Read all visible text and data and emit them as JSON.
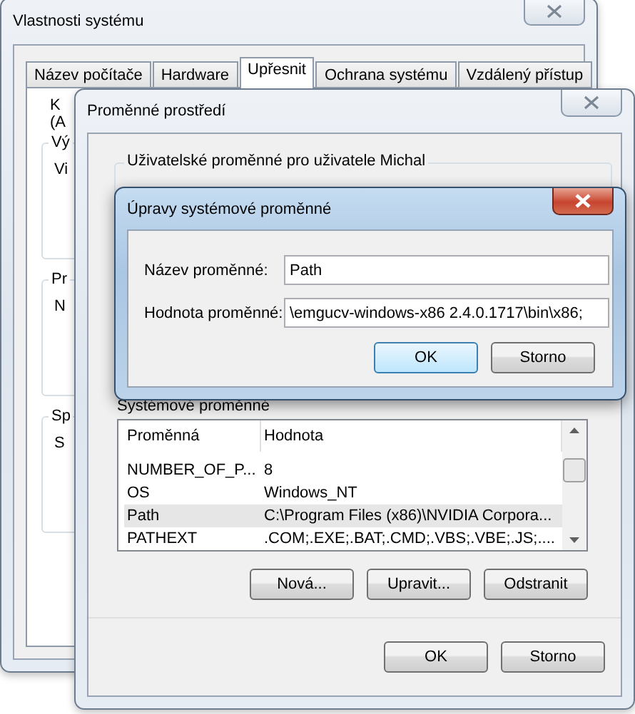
{
  "system_properties": {
    "title": "Vlastnosti systému",
    "tabs": [
      {
        "label": "Název počítače",
        "selected": false
      },
      {
        "label": "Hardware",
        "selected": false
      },
      {
        "label": "Upřesnit",
        "selected": true
      },
      {
        "label": "Ochrana systému",
        "selected": false
      },
      {
        "label": "Vzdálený přístup",
        "selected": false
      }
    ],
    "intro_lines": [
      "K",
      "(A"
    ],
    "groups": [
      {
        "legend": "Vý",
        "line": "Vi"
      },
      {
        "legend": "Pr",
        "line": "N"
      },
      {
        "legend": "Sp",
        "line": "S"
      }
    ]
  },
  "environment_variables": {
    "title": "Proměnné prostředí",
    "user_section": "Uživatelské proměnné pro uživatele Michal",
    "system_section": "Systémové proměnné",
    "columns": [
      "Proměnná",
      "Hodnota"
    ],
    "rows": [
      {
        "name": "NUMBER_OF_P...",
        "value": "8",
        "selected": false
      },
      {
        "name": "OS",
        "value": "Windows_NT",
        "selected": false
      },
      {
        "name": "Path",
        "value": "C:\\Program Files (x86)\\NVIDIA Corpora...",
        "selected": true
      },
      {
        "name": "PATHEXT",
        "value": ".COM;.EXE;.BAT;.CMD;.VBS;.VBE;.JS;....",
        "selected": false
      }
    ],
    "list_buttons": [
      "Nová...",
      "Upravit...",
      "Odstranit"
    ],
    "buttons": [
      "OK",
      "Storno"
    ]
  },
  "edit_dialog": {
    "title": "Úpravy systémové proměnné",
    "fields": [
      {
        "label": "Název proměnné:",
        "value": "Path"
      },
      {
        "label": "Hodnota proměnné:",
        "value": "\\emgucv-windows-x86 2.4.0.1717\\bin\\x86;"
      }
    ],
    "buttons": [
      {
        "label": "OK",
        "default": true
      },
      {
        "label": "Storno",
        "default": false
      }
    ]
  }
}
